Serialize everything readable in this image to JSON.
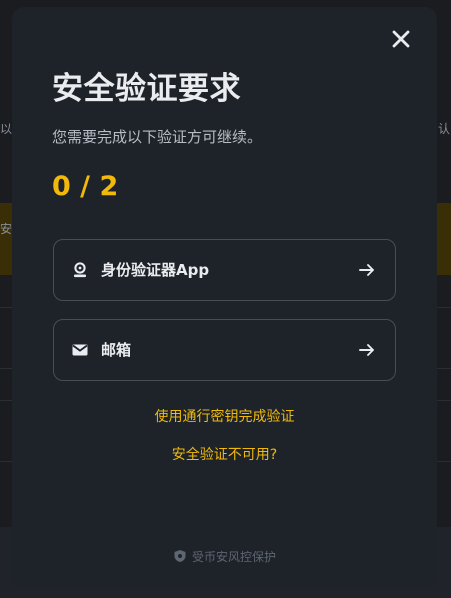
{
  "modal": {
    "title": "安全验证要求",
    "subtitle": "您需要完成以下验证方可继续。",
    "progress": "0 / 2",
    "options": [
      {
        "label": "身份验证器App",
        "icon": "authenticator-icon"
      },
      {
        "label": "邮箱",
        "icon": "mail-icon"
      }
    ],
    "links": {
      "passkey": "使用通行密钥完成验证",
      "unavailable": "安全验证不可用?"
    },
    "footer": "受币安风控保护"
  },
  "background": {
    "left_fragment": "以",
    "right_fragment": "认",
    "yellow_fragment": "安"
  },
  "colors": {
    "accent": "#f0b90b",
    "modal_bg": "#1e2329",
    "text_primary": "#eaecef",
    "text_secondary": "#b7bdc6"
  }
}
